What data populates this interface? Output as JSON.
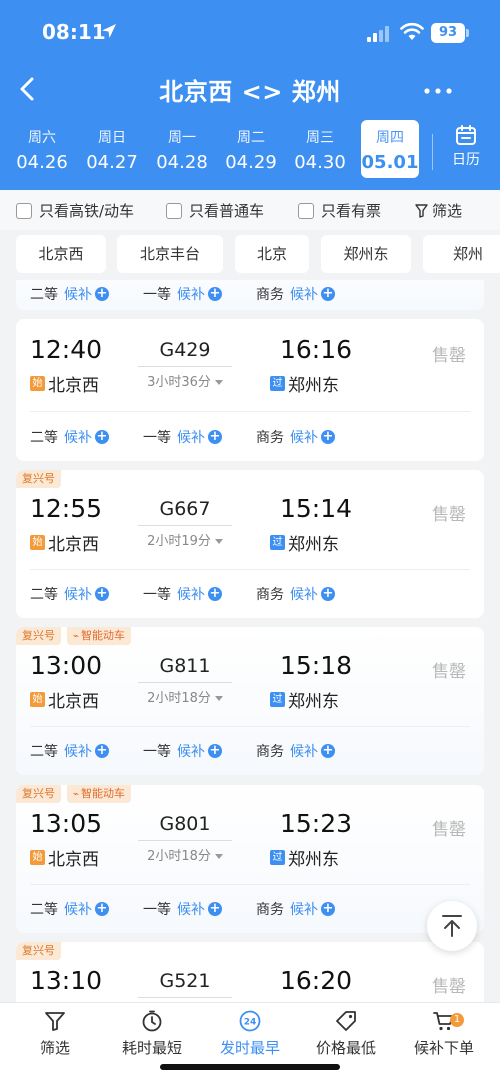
{
  "status": {
    "time": "08:11",
    "battery": "93"
  },
  "nav": {
    "title": "北京西 <> 郑州"
  },
  "dates": [
    {
      "weekday": "周六",
      "date": "04.26",
      "selected": false
    },
    {
      "weekday": "周日",
      "date": "04.27",
      "selected": false
    },
    {
      "weekday": "周一",
      "date": "04.28",
      "selected": false
    },
    {
      "weekday": "周二",
      "date": "04.29",
      "selected": false
    },
    {
      "weekday": "周三",
      "date": "04.30",
      "selected": false
    },
    {
      "weekday": "周四",
      "date": "05.01",
      "selected": true
    }
  ],
  "calendar_label": "日历",
  "filters": {
    "high_speed": "只看高铁/动车",
    "normal": "只看普通车",
    "available": "只看有票",
    "filter": "筛选"
  },
  "stations": [
    "北京西",
    "北京丰台",
    "北京",
    "郑州东",
    "郑州"
  ],
  "partial_card": {
    "seats": [
      {
        "name": "二等",
        "status": "候补"
      },
      {
        "name": "一等",
        "status": "候补"
      },
      {
        "name": "商务",
        "status": "候补"
      }
    ]
  },
  "trains": [
    {
      "tags": [],
      "dep_time": "12:40",
      "train_no": "G429",
      "arr_time": "16:16",
      "duration": "3小时36分",
      "dep_badge": "始",
      "dep_station": "北京西",
      "arr_badge": "过",
      "arr_station": "郑州东",
      "sold": "售罄",
      "seats": [
        {
          "name": "二等",
          "status": "候补"
        },
        {
          "name": "一等",
          "status": "候补"
        },
        {
          "name": "商务",
          "status": "候补"
        }
      ]
    },
    {
      "tags": [
        "复兴号"
      ],
      "dep_time": "12:55",
      "train_no": "G667",
      "arr_time": "15:14",
      "duration": "2小时19分",
      "dep_badge": "始",
      "dep_station": "北京西",
      "arr_badge": "过",
      "arr_station": "郑州东",
      "sold": "售罄",
      "seats": [
        {
          "name": "二等",
          "status": "候补"
        },
        {
          "name": "一等",
          "status": "候补"
        },
        {
          "name": "商务",
          "status": "候补"
        }
      ]
    },
    {
      "tags": [
        "复兴号",
        "智能动车"
      ],
      "dep_time": "13:00",
      "train_no": "G811",
      "arr_time": "15:18",
      "duration": "2小时18分",
      "dep_badge": "始",
      "dep_station": "北京西",
      "arr_badge": "过",
      "arr_station": "郑州东",
      "sold": "售罄",
      "seats": [
        {
          "name": "二等",
          "status": "候补"
        },
        {
          "name": "一等",
          "status": "候补"
        },
        {
          "name": "商务",
          "status": "候补"
        }
      ]
    },
    {
      "tags": [
        "复兴号",
        "智能动车"
      ],
      "dep_time": "13:05",
      "train_no": "G801",
      "arr_time": "15:23",
      "duration": "2小时18分",
      "dep_badge": "始",
      "dep_station": "北京西",
      "arr_badge": "过",
      "arr_station": "郑州东",
      "sold": "售罄",
      "seats": [
        {
          "name": "二等",
          "status": "候补"
        },
        {
          "name": "一等",
          "status": "候补"
        },
        {
          "name": "商务",
          "status": "候补"
        }
      ]
    },
    {
      "tags": [
        "复兴号"
      ],
      "dep_time": "13:10",
      "train_no": "G521",
      "arr_time": "16:20",
      "sold": "售罄"
    }
  ],
  "bottom": {
    "filter": "筛选",
    "shortest": "耗时最短",
    "earliest": "发时最早",
    "earliest_icon_text": "24",
    "cheapest": "价格最低",
    "waitlist": "候补下单",
    "cart_count": "1"
  },
  "colors": {
    "primary": "#3d8ff2",
    "tag_orange": "#d9782b",
    "sold_gray": "#b8b8b8"
  }
}
